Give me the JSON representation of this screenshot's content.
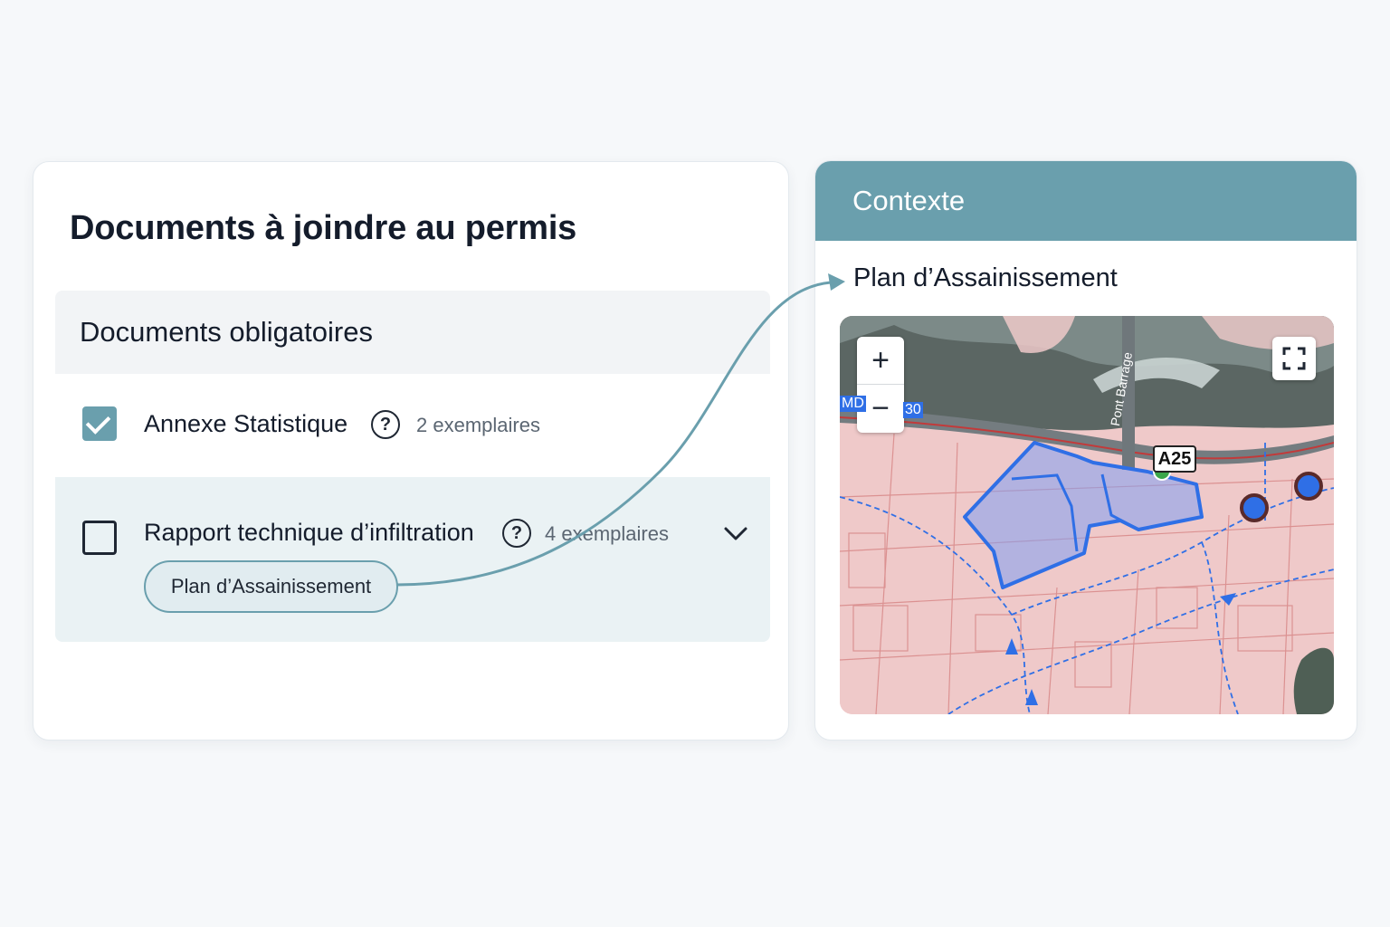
{
  "left_panel": {
    "title": "Documents à joindre au permis",
    "section": {
      "title": "Documents obligatoires",
      "items": [
        {
          "label": "Annexe Statistique",
          "copies": "2 exemplaires",
          "checked": true
        },
        {
          "label": "Rapport technique d’infiltration",
          "copies": "4 exemplaires",
          "checked": false,
          "tag": "Plan d’Assainissement"
        }
      ]
    }
  },
  "right_panel": {
    "header": "Contexte",
    "subtitle": "Plan d’Assainissement",
    "map": {
      "road_badge": "A25",
      "road_label_left": "MD",
      "road_label_number": "30",
      "street_label": "Pont Barrage",
      "zoom_in": "+",
      "zoom_out": "−",
      "fullscreen_icon": "fullscreen-icon"
    }
  },
  "colors": {
    "accent": "#6a9fad",
    "row_highlight": "#eaf2f4",
    "map_overlay": "#efc9c9",
    "parcel_blue": "#2f6fe6"
  }
}
